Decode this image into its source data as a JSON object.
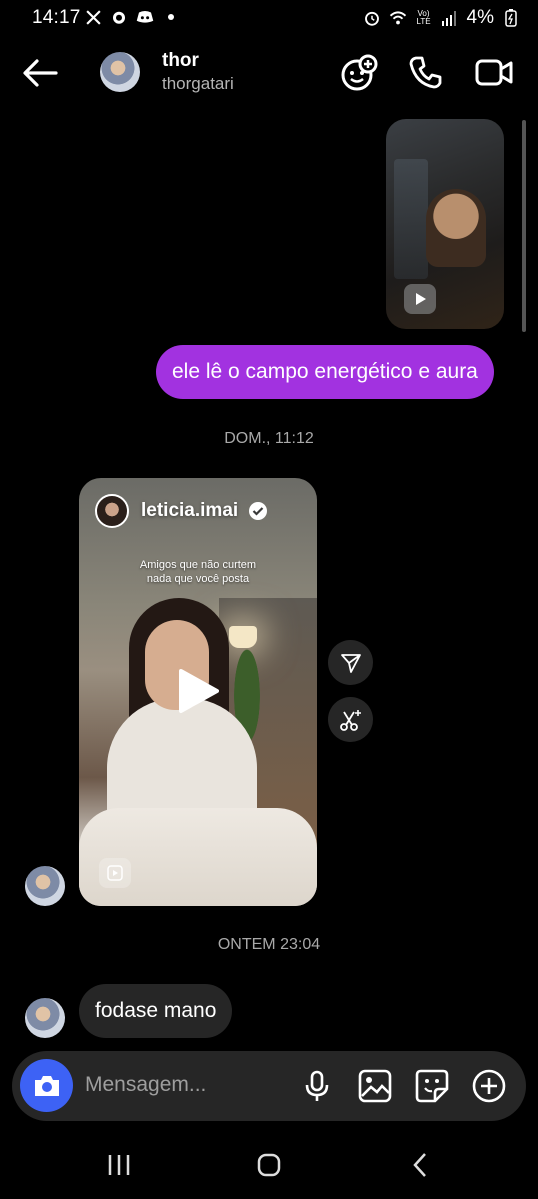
{
  "status_bar": {
    "time": "14:17",
    "battery": "4%",
    "network_label": "Vo) LTE"
  },
  "header": {
    "name": "thor",
    "username": "thorgatari"
  },
  "messages": {
    "sent_text": "ele lê o campo energético e aura",
    "timestamp1": "DOM., 11:12",
    "reel_author": "leticia.imai",
    "reel_caption_line1": "Amigos que não curtem",
    "reel_caption_line2": "nada que você posta",
    "timestamp2": "ONTEM 23:04",
    "received_text": "fodase mano"
  },
  "composer": {
    "placeholder": "Mensagem..."
  },
  "colors": {
    "sent_bubble": "#a232e0",
    "camera_button": "#3d62f5",
    "received_bubble": "#262626"
  }
}
